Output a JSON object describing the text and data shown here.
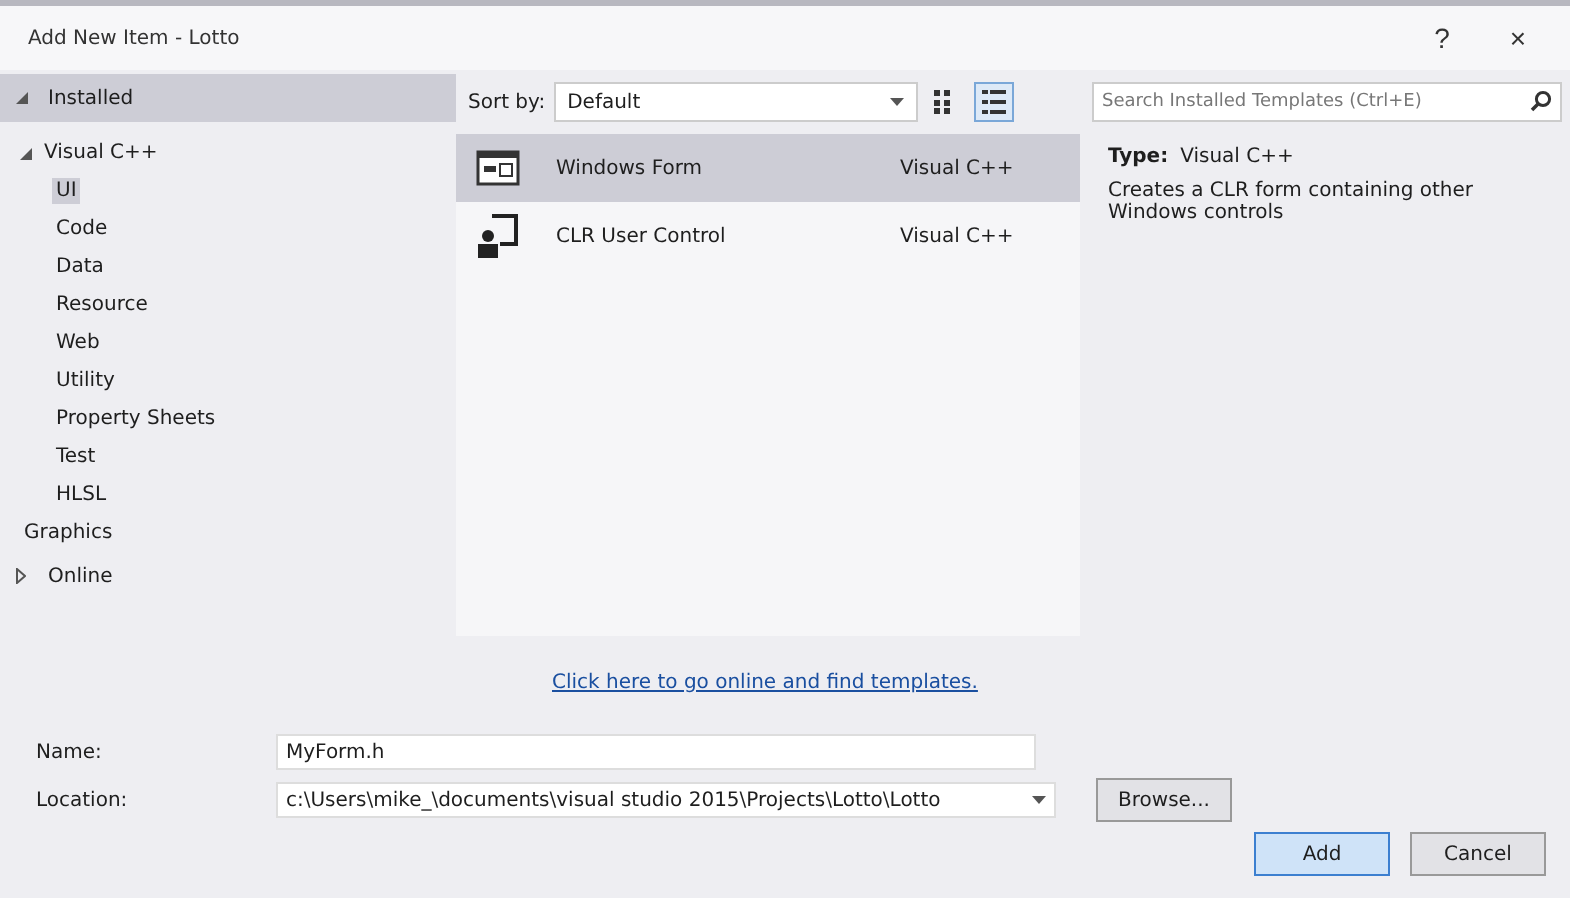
{
  "window": {
    "title": "Add New Item - Lotto",
    "help": "?",
    "close": "×"
  },
  "tree": [
    {
      "label": "Installed",
      "expanded": true,
      "selected": true,
      "children": [
        {
          "label": "Visual C++",
          "expanded": true,
          "selected": false,
          "children": [
            {
              "label": "UI",
              "selected": true
            },
            {
              "label": "Code",
              "selected": false
            },
            {
              "label": "Data",
              "selected": false
            },
            {
              "label": "Resource",
              "selected": false
            },
            {
              "label": "Web",
              "selected": false
            },
            {
              "label": "Utility",
              "selected": false
            },
            {
              "label": "Property Sheets",
              "selected": false
            },
            {
              "label": "Test",
              "selected": false
            },
            {
              "label": "HLSL",
              "selected": false
            }
          ]
        },
        {
          "label": "Graphics",
          "selected": false
        }
      ]
    },
    {
      "label": "Online",
      "expanded": false,
      "selected": false
    }
  ],
  "sort": {
    "label": "Sort by:",
    "value": "Default"
  },
  "view_modes": [
    {
      "kind": "grid",
      "selected": false
    },
    {
      "kind": "list",
      "selected": true
    }
  ],
  "templates": [
    {
      "name": "Windows Form",
      "type": "Visual C++",
      "kind": "form",
      "selected": true
    },
    {
      "name": "CLR User Control",
      "type": "Visual C++",
      "kind": "control",
      "selected": false
    }
  ],
  "online_link": "Click here to go online and find templates.",
  "search": {
    "placeholder": "Search Installed Templates (Ctrl+E)"
  },
  "details": {
    "type_label": "Type:",
    "type_value": "Visual C++",
    "description": "Creates a CLR form containing other Windows controls"
  },
  "name_field": {
    "label": "Name:",
    "value": "MyForm.h"
  },
  "location_field": {
    "label": "Location:",
    "value": "c:\\Users\\mike_\\documents\\visual studio 2015\\Projects\\Lotto\\Lotto"
  },
  "buttons": [
    {
      "label": "Browse...",
      "kind": "browse"
    },
    {
      "label": "Add",
      "kind": "add"
    },
    {
      "label": "Cancel",
      "kind": "cancel"
    }
  ]
}
